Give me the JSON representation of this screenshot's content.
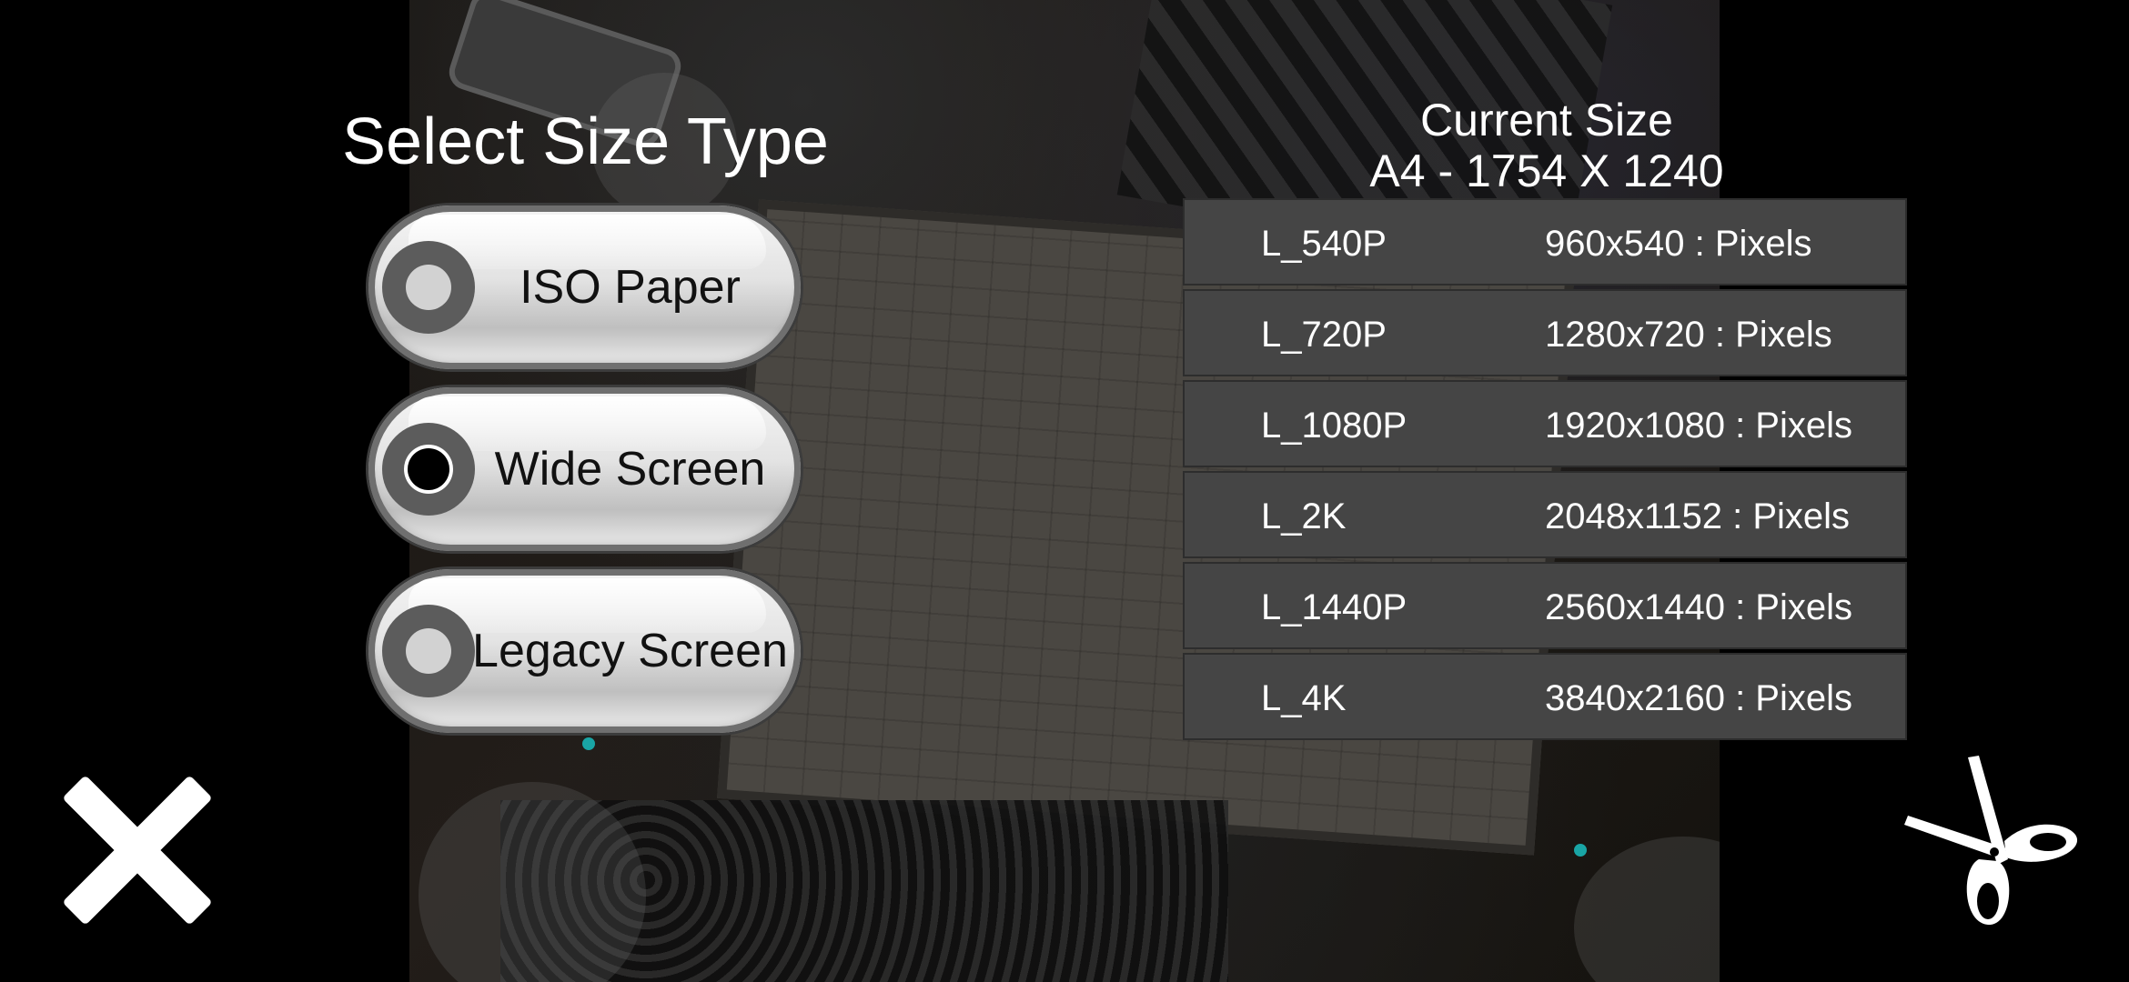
{
  "size_type": {
    "title": "Select Size Type",
    "options": [
      {
        "label": "ISO Paper",
        "selected": false
      },
      {
        "label": "Wide Screen",
        "selected": true
      },
      {
        "label": "Legacy Screen",
        "selected": false
      }
    ]
  },
  "current_size": {
    "heading": "Current Size",
    "value": "A4 - 1754 X 1240"
  },
  "sizes": [
    {
      "name": "L_540P",
      "resolution": "960x540 : Pixels"
    },
    {
      "name": "L_720P",
      "resolution": "1280x720 : Pixels"
    },
    {
      "name": "L_1080P",
      "resolution": "1920x1080 : Pixels"
    },
    {
      "name": "L_2K",
      "resolution": "2048x1152 : Pixels"
    },
    {
      "name": "L_1440P",
      "resolution": "2560x1440 : Pixels"
    },
    {
      "name": "L_4K",
      "resolution": "3840x2160 : Pixels"
    }
  ],
  "icons": {
    "close": "close-icon",
    "crop": "scissors-icon"
  },
  "colors": {
    "row_bg": "#454545",
    "accent_marker": "#19a5a5",
    "radio_selected": "#000000"
  }
}
